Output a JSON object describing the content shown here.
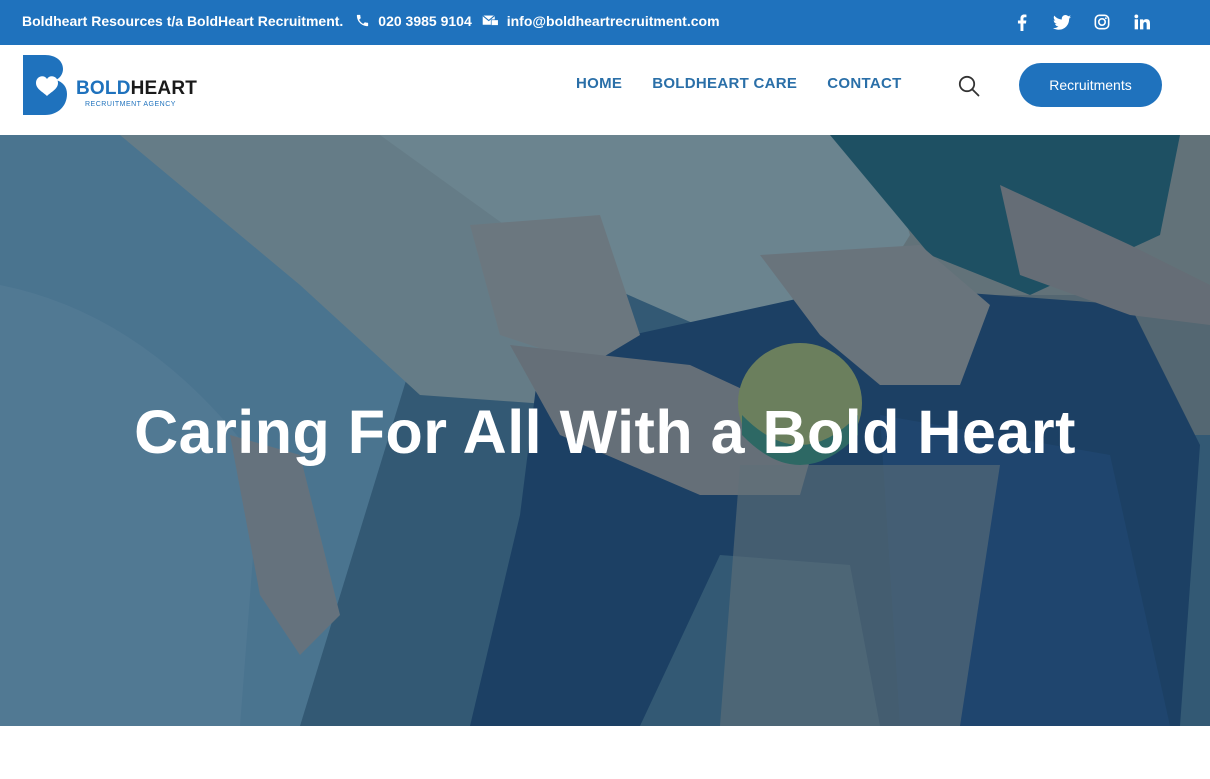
{
  "topbar": {
    "company": "Boldheart Resources t/a BoldHeart Recruitment.",
    "phone": "020 3985 9104",
    "email": "info@boldheartrecruitment.com",
    "social_icons": [
      "facebook-icon",
      "twitter-icon",
      "instagram-icon",
      "linkedin-icon"
    ],
    "background": "#1f72bd"
  },
  "header": {
    "logo": {
      "bold": "BOLD",
      "heart": "HEART",
      "tagline": "RECRUITMENT AGENCY"
    },
    "nav": [
      "HOME",
      "BOLDHEART CARE",
      "CONTACT"
    ],
    "cta_label": "Recruitments",
    "accent": "#1f72bd"
  },
  "hero": {
    "title": "Caring For All With a Bold Heart",
    "overlay_color": "#12486e"
  }
}
